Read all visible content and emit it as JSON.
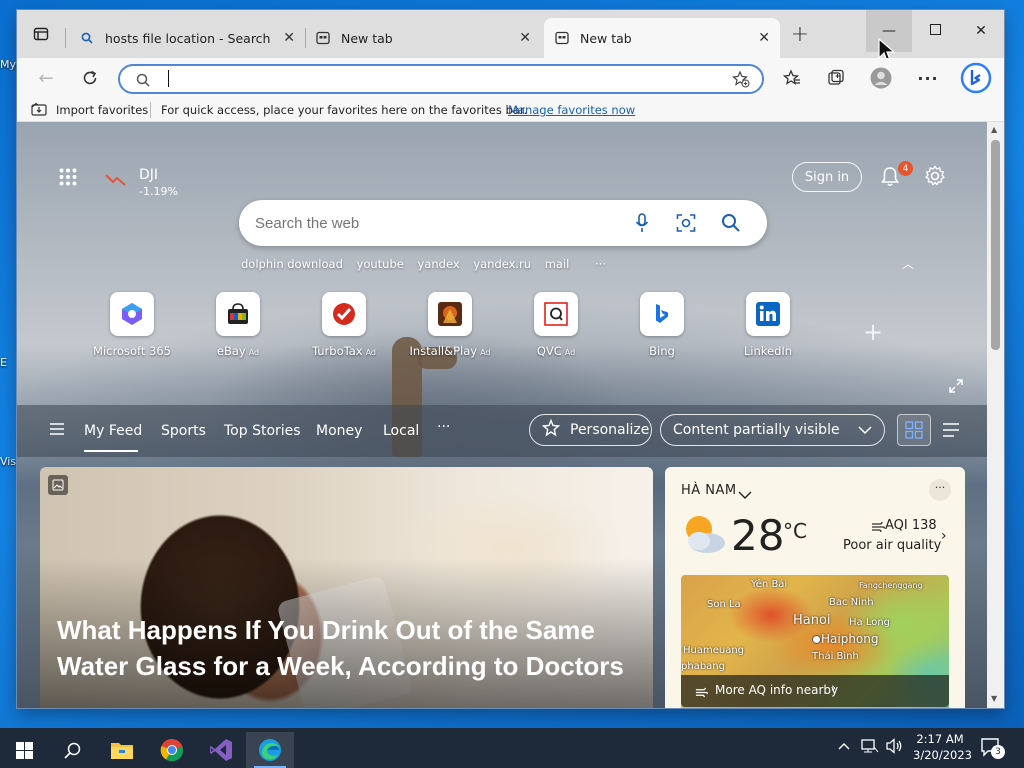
{
  "desktop": {
    "icon_labels": [
      "My",
      "E",
      "Vis"
    ]
  },
  "browser": {
    "tabs": [
      {
        "label": "hosts file location - Search",
        "icon": "search-icon"
      },
      {
        "label": "New tab",
        "icon": "newtab-icon"
      },
      {
        "label": "New tab",
        "icon": "newtab-icon",
        "active": true
      }
    ],
    "address": {
      "value": "",
      "placeholder": ""
    },
    "favorites_bar": {
      "import_label": "Import favorites",
      "hint": "For quick access, place your favorites here on the favorites bar.",
      "manage_link": "Manage favorites now"
    }
  },
  "newtab": {
    "ticker": {
      "symbol": "DJI",
      "change": "-1.19%"
    },
    "sign_in": "Sign in",
    "notifications_count": "4",
    "search": {
      "placeholder": "Search the web"
    },
    "trending": [
      "dolphin download",
      "youtube",
      "yandex",
      "yandex.ru",
      "mail"
    ],
    "more_glyph": "···",
    "quick_links": [
      {
        "label": "Microsoft 365",
        "ad": ""
      },
      {
        "label": "eBay",
        "ad": "Ad"
      },
      {
        "label": "TurboTax",
        "ad": "Ad"
      },
      {
        "label": "Install&Play",
        "ad": "Ad"
      },
      {
        "label": "QVC",
        "ad": "Ad"
      },
      {
        "label": "Bing",
        "ad": ""
      },
      {
        "label": "LinkedIn",
        "ad": ""
      }
    ],
    "feed_nav": {
      "items": [
        "My Feed",
        "Sports",
        "Top Stories",
        "Money",
        "Local"
      ],
      "personalize": "Personalize",
      "visibility": "Content partially visible"
    },
    "hero": {
      "headline": "What Happens If You Drink Out of the Same Water Glass for a Week, According to Doctors"
    },
    "weather": {
      "location": "HÀ NAM",
      "temp": "28",
      "unit": "°C",
      "aqi": "AQI 138",
      "quality": "Poor air quality",
      "map_labels": [
        "Yên Bái",
        "Bac Ninh",
        "Fangchenggang",
        "Son La",
        "Hanoi",
        "Ha Long",
        "Haiphong",
        "Huameuang",
        "Thái Bình",
        "phabang"
      ],
      "more_aq": "More AQ info nearby"
    }
  },
  "taskbar": {
    "time": "2:17 AM",
    "date": "3/20/2023",
    "notifications": "3"
  },
  "colors": {
    "accent": "#0f6cbd",
    "address_border": "#4f86d6",
    "taskbar": "#1e2a3a"
  }
}
